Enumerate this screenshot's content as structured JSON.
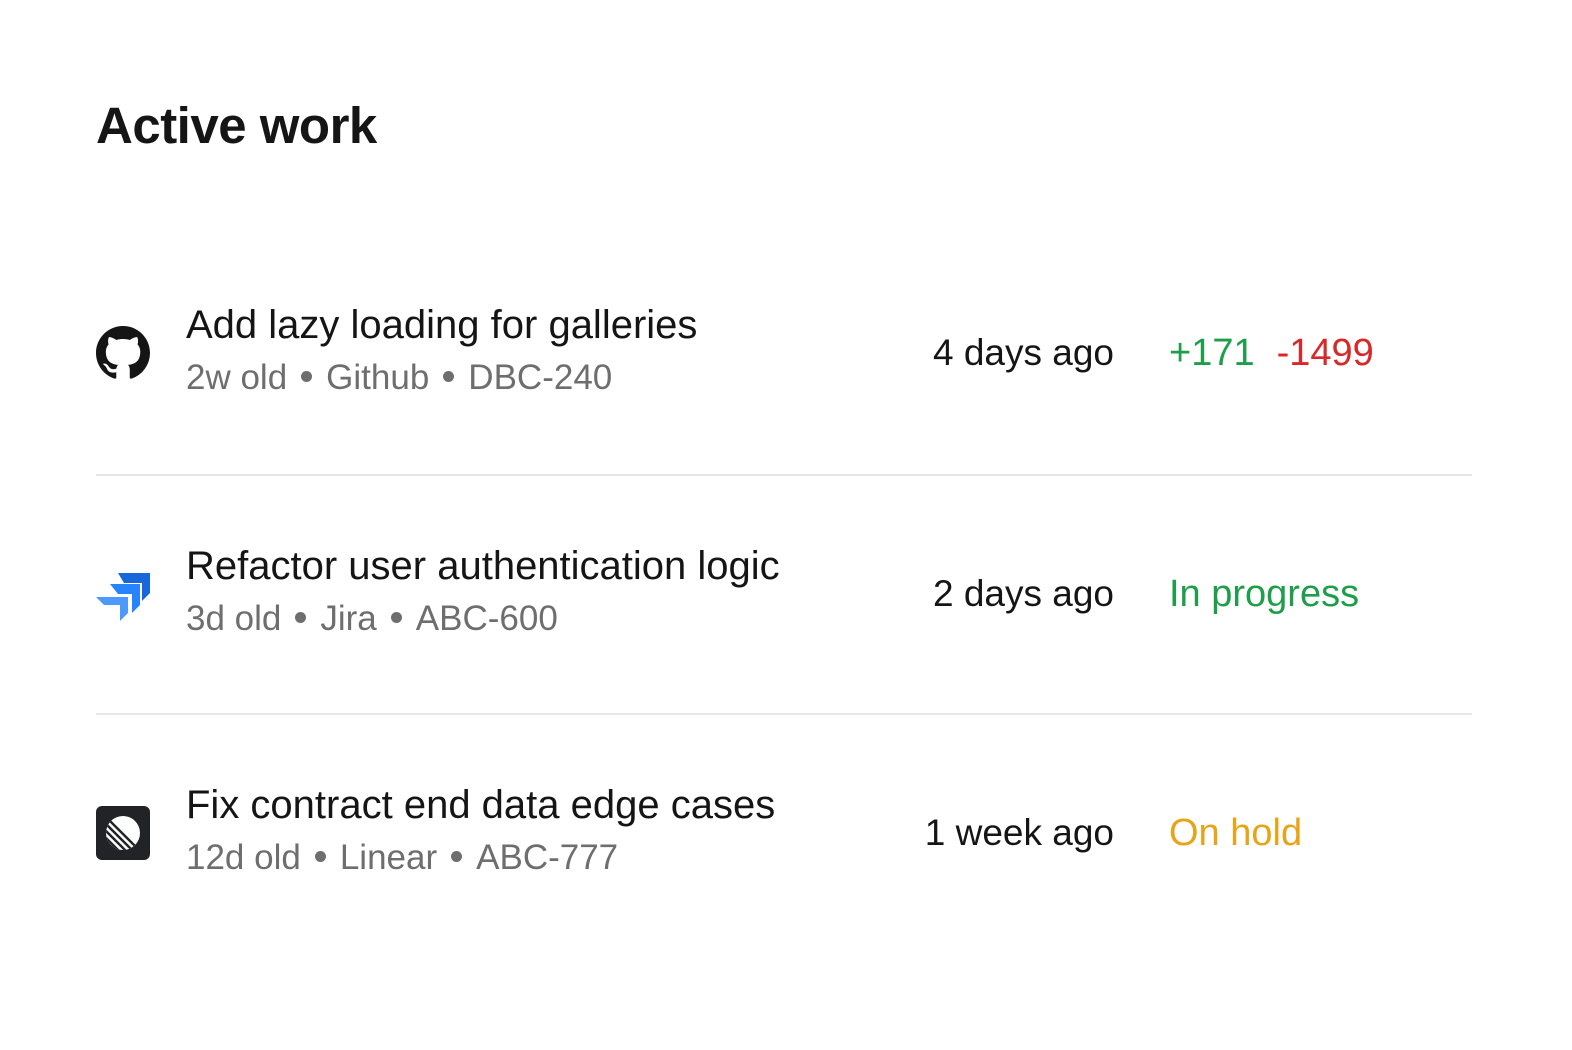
{
  "page": {
    "title": "Active work"
  },
  "items": [
    {
      "source_icon": "github-icon",
      "title": "Add lazy loading for galleries",
      "age": "2w old",
      "source": "Github",
      "ticket": "DBC-240",
      "updated": "4 days ago",
      "additions": "+171",
      "deletions": "-1499"
    },
    {
      "source_icon": "jira-icon",
      "title": "Refactor user authentication logic",
      "age": "3d old",
      "source": "Jira",
      "ticket": "ABC-600",
      "updated": "2 days ago",
      "status": "In progress",
      "status_color": "#1e9e4a"
    },
    {
      "source_icon": "linear-icon",
      "title": "Fix contract end data edge cases",
      "age": "12d old",
      "source": "Linear",
      "ticket": "ABC-777",
      "updated": "1 week ago",
      "status": "On hold",
      "status_color": "#e8a416"
    }
  ],
  "colors": {
    "additions": "#1e9e4a",
    "deletions": "#d7282a",
    "jira_blue": "#2684ff",
    "linear_dark": "#222326"
  }
}
